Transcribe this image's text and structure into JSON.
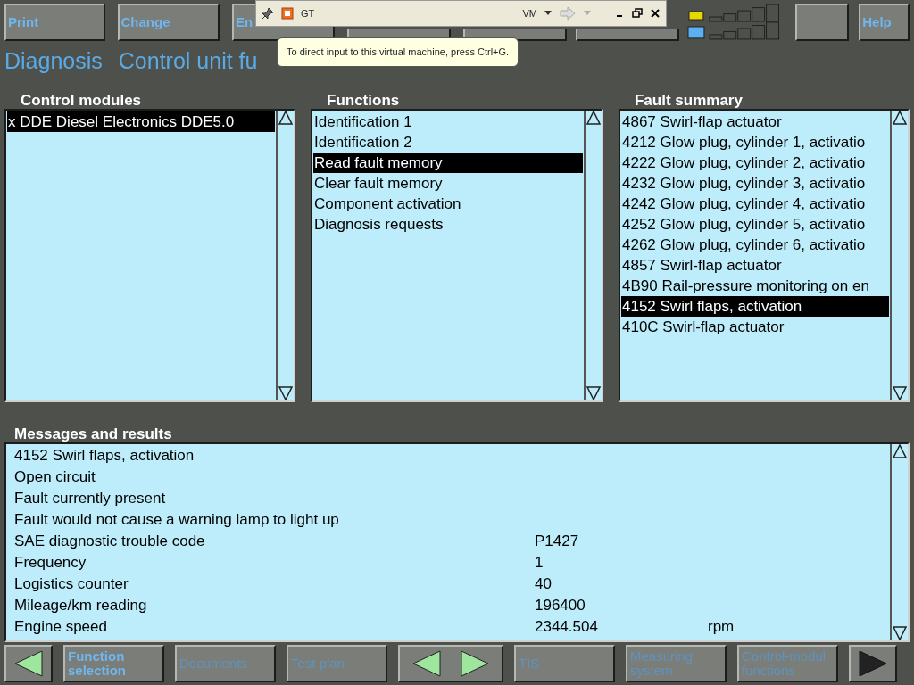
{
  "top_buttons": [
    {
      "kind": "text",
      "label": "Print"
    },
    {
      "kind": "text",
      "label": "Change"
    },
    {
      "kind": "text",
      "label": "En"
    },
    {
      "kind": "blank"
    },
    {
      "kind": "blank"
    },
    {
      "kind": "blank"
    },
    {
      "kind": "status"
    },
    {
      "kind": "blank"
    },
    {
      "kind": "text",
      "label": "Help"
    }
  ],
  "vm_toolbar": {
    "title": "GT",
    "menu": "VM"
  },
  "tooltip": "To direct input to this virtual machine, press Ctrl+G.",
  "heading": [
    "Diagnosis",
    "Control unit fu"
  ],
  "panels": [
    {
      "title": "Control modules",
      "items": [
        {
          "label": "x DDE Diesel Electronics DDE5.0",
          "selected": true
        }
      ]
    },
    {
      "title": "Functions",
      "items": [
        {
          "label": "Identification 1",
          "selected": false
        },
        {
          "label": "Identification 2",
          "selected": false
        },
        {
          "label": "Read fault memory",
          "selected": true
        },
        {
          "label": "Clear fault memory",
          "selected": false
        },
        {
          "label": "Component activation",
          "selected": false
        },
        {
          "label": "Diagnosis requests",
          "selected": false
        }
      ]
    },
    {
      "title": "Fault summary",
      "items": [
        {
          "label": "4867 Swirl-flap actuator",
          "selected": false
        },
        {
          "label": "4212 Glow plug, cylinder 1, activatio",
          "selected": false
        },
        {
          "label": "4222 Glow plug, cylinder 2, activatio",
          "selected": false
        },
        {
          "label": "4232 Glow plug, cylinder 3, activatio",
          "selected": false
        },
        {
          "label": "4242 Glow plug, cylinder 4, activatio",
          "selected": false
        },
        {
          "label": "4252 Glow plug, cylinder 5, activatio",
          "selected": false
        },
        {
          "label": "4262 Glow plug, cylinder 6, activatio",
          "selected": false
        },
        {
          "label": "4857 Swirl-flap actuator",
          "selected": false
        },
        {
          "label": "4B90 Rail-pressure monitoring on en",
          "selected": false
        },
        {
          "label": "4152 Swirl flaps, activation",
          "selected": true
        },
        {
          "label": "410C Swirl-flap actuator",
          "selected": false
        }
      ]
    }
  ],
  "messages": {
    "title": "Messages and results",
    "rows": [
      {
        "label": "4152 Swirl flaps, activation"
      },
      {
        "label": "Open circuit"
      },
      {
        "label": "Fault currently present"
      },
      {
        "label": "Fault would not cause a warning lamp to light up"
      },
      {
        "label": "SAE diagnostic trouble code",
        "value": "P1427"
      },
      {
        "label": "Frequency",
        "value": "1"
      },
      {
        "label": "Logistics counter",
        "value": "40"
      },
      {
        "label": "Mileage/km reading",
        "value": "196400"
      },
      {
        "label": "Engine speed",
        "value": "2344.504",
        "unit": "rpm"
      }
    ]
  },
  "bottom_buttons": [
    {
      "kind": "back"
    },
    {
      "kind": "text",
      "label": "Function selection",
      "disabled": false
    },
    {
      "kind": "text",
      "label": "Documents",
      "disabled": true
    },
    {
      "kind": "text",
      "label": "Test plan",
      "disabled": true
    },
    {
      "kind": "nav"
    },
    {
      "kind": "text",
      "label": "TIS",
      "disabled": true
    },
    {
      "kind": "text",
      "label": "Measuring system",
      "disabled": true
    },
    {
      "kind": "text",
      "label": "Control-modul functions",
      "disabled": true
    },
    {
      "kind": "forward"
    }
  ]
}
